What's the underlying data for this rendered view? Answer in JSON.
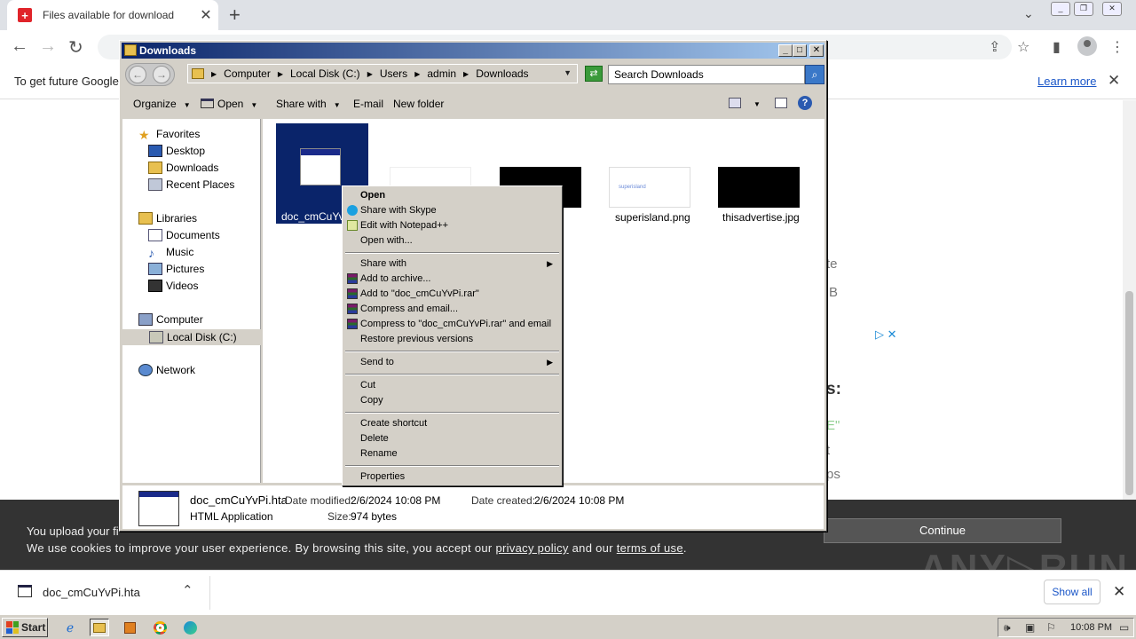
{
  "browser": {
    "tab_title": "Files available for download",
    "tab_close": "✕",
    "new_tab": "+",
    "infobar_message": "To get future Google",
    "infobar_link": "Learn more",
    "infobar_close": "✕"
  },
  "page_fragments": {
    "frag1": "te",
    "frag2": "B",
    "frag3": "s:",
    "frag4": "E\"",
    "frag5": "t",
    "frag6": "ps"
  },
  "cookie": {
    "line1": "You upload your fi",
    "line2_pre": "We use cookies to improve your user experience. By browsing this site, you accept our",
    "privacy": "privacy policy",
    "and": "and our",
    "terms": "terms of use",
    "period": ".",
    "continue": "Continue",
    "watermark": "ANY▷RUN"
  },
  "download_bar": {
    "file": "doc_cmCuYvPi.hta",
    "show_all": "Show all",
    "close": "✕"
  },
  "explorer": {
    "title": "Downloads",
    "breadcrumb": [
      "Computer",
      "Local Disk (C:)",
      "Users",
      "admin",
      "Downloads"
    ],
    "search_placeholder": "Search Downloads",
    "commands": {
      "organize": "Organize",
      "open": "Open",
      "share_with": "Share with",
      "email": "E-mail",
      "new_folder": "New folder"
    },
    "nav": {
      "favorites": "Favorites",
      "desktop": "Desktop",
      "downloads": "Downloads",
      "recent": "Recent Places",
      "libraries": "Libraries",
      "documents": "Documents",
      "music": "Music",
      "pictures": "Pictures",
      "videos": "Videos",
      "computer": "Computer",
      "local_disk": "Local Disk (C:)",
      "network": "Network"
    },
    "files": [
      {
        "name": "doc_cmCuYvPi.hta"
      },
      {
        "name": "g"
      },
      {
        "name": "superisland.png",
        "thumb_text": "superisland"
      },
      {
        "name": "thisadvertise.jpg"
      }
    ],
    "selected_label": "doc_cmCuYvP",
    "details": {
      "name": "doc_cmCuYvPi.hta",
      "type": "HTML Application",
      "modified_label": "Date modified:",
      "modified": "2/6/2024 10:08 PM",
      "created_label": "Date created:",
      "created": "2/6/2024 10:08 PM",
      "size_label": "Size:",
      "size": "974 bytes"
    }
  },
  "context_menu": {
    "open": "Open",
    "share_skype": "Share with Skype",
    "edit_npp": "Edit with Notepad++",
    "open_with": "Open with...",
    "share_with": "Share with",
    "add_archive": "Add to archive...",
    "add_rar": "Add to \"doc_cmCuYvPi.rar\"",
    "compress_email": "Compress and email...",
    "compress_rar_email": "Compress to \"doc_cmCuYvPi.rar\" and email",
    "restore": "Restore previous versions",
    "send_to": "Send to",
    "cut": "Cut",
    "copy": "Copy",
    "create_shortcut": "Create shortcut",
    "delete": "Delete",
    "rename": "Rename",
    "properties": "Properties"
  },
  "taskbar": {
    "start": "Start",
    "clock": "10:08 PM"
  }
}
